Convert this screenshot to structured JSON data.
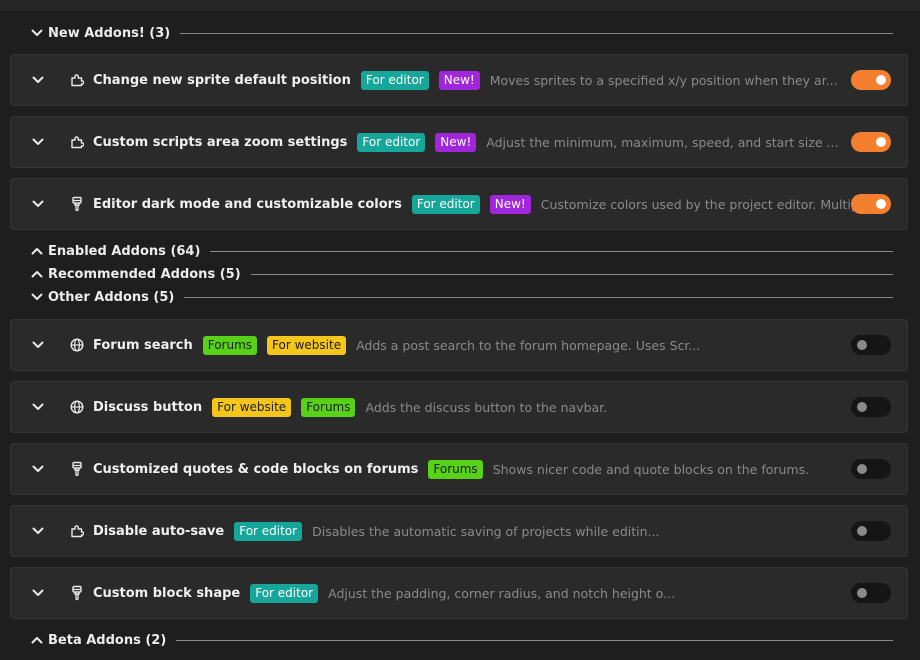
{
  "colors": {
    "background": "#1e1e1e",
    "row_background": "#2a2a2a",
    "toggle_on": "#f47f2f",
    "toggle_off": "#151515",
    "tag_editor": "#17a79a",
    "tag_new": "#a125db",
    "tag_forums": "#57d218",
    "tag_website": "#f4c51a"
  },
  "sections": {
    "new": {
      "label": "New Addons! (3)",
      "expanded": true
    },
    "enabled": {
      "label": "Enabled Addons (64)",
      "expanded": false
    },
    "recommended": {
      "label": "Recommended Addons (5)",
      "expanded": false
    },
    "other": {
      "label": "Other Addons (5)",
      "expanded": true
    },
    "beta": {
      "label": "Beta Addons (2)",
      "expanded": false
    }
  },
  "new_addons": [
    {
      "icon": "puzzle-icon",
      "name": "Change new sprite default position",
      "tags": [
        "For editor",
        "New!"
      ],
      "description": "Moves sprites to a specified x/y position when they ar...",
      "enabled": true
    },
    {
      "icon": "puzzle-icon",
      "name": "Custom scripts area zoom settings",
      "tags": [
        "For editor",
        "New!"
      ],
      "description": "Adjust the minimum, maximum, speed, and start size ...",
      "enabled": true
    },
    {
      "icon": "brush-icon",
      "name": "Editor dark mode and customizable colors",
      "tags": [
        "For editor",
        "New!"
      ],
      "description": "Customize colors used by the project editor. Multiple ...",
      "enabled": true
    }
  ],
  "other_addons": [
    {
      "icon": "globe-icon",
      "name": "Forum search",
      "tags": [
        "Forums",
        "For website"
      ],
      "description": "Adds a post search to the forum homepage. Uses Scr...",
      "enabled": false
    },
    {
      "icon": "globe-icon",
      "name": "Discuss button",
      "tags": [
        "For website",
        "Forums"
      ],
      "description": "Adds the discuss button to the navbar.",
      "enabled": false
    },
    {
      "icon": "brush-icon",
      "name": "Customized quotes & code blocks on forums",
      "tags": [
        "Forums"
      ],
      "description": "Shows nicer code and quote blocks on the forums.",
      "enabled": false
    },
    {
      "icon": "puzzle-icon",
      "name": "Disable auto-save",
      "tags": [
        "For editor"
      ],
      "description": "Disables the automatic saving of projects while editin...",
      "enabled": false
    },
    {
      "icon": "brush-icon",
      "name": "Custom block shape",
      "tags": [
        "For editor"
      ],
      "description": "Adjust the padding, corner radius, and notch height o...",
      "enabled": false
    }
  ]
}
